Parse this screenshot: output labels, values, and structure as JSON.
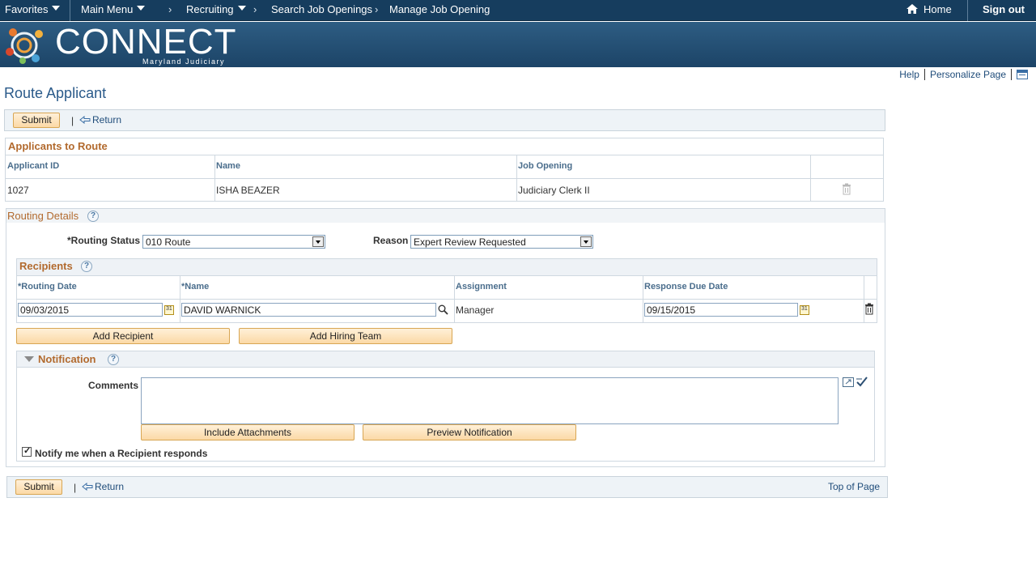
{
  "nav": {
    "favorites": "Favorites",
    "main_menu": "Main Menu",
    "crumbs": [
      "Recruiting",
      "Search Job Openings",
      "Manage Job Opening"
    ],
    "home": "Home",
    "sign_out": "Sign out"
  },
  "banner": {
    "logo_text": "CONNECT",
    "logo_sub": "Maryland Judiciary"
  },
  "page_links": {
    "help": "Help",
    "personalize": "Personalize Page"
  },
  "page_title": "Route Applicant",
  "toolbar": {
    "submit": "Submit",
    "return": "Return",
    "pipe": "|"
  },
  "applicants": {
    "title": "Applicants to Route",
    "headers": [
      "Applicant ID",
      "Name",
      "Job Opening"
    ],
    "rows": [
      {
        "id": "1027",
        "name": "ISHA BEAZER",
        "job": "Judiciary Clerk II"
      }
    ]
  },
  "routing": {
    "title": "Routing Details",
    "status_label": "*Routing Status",
    "status_value": "010 Route",
    "reason_label": "Reason",
    "reason_value": "Expert Review Requested"
  },
  "recipients": {
    "title": "Recipients",
    "headers": [
      "*Routing Date",
      "*Name",
      "Assignment",
      "Response Due Date"
    ],
    "rows": [
      {
        "date": "09/03/2015",
        "name": "DAVID WARNICK",
        "assignment": "Manager",
        "due": "09/15/2015"
      }
    ],
    "add_recipient": "Add Recipient",
    "add_hiring_team": "Add Hiring Team"
  },
  "notification": {
    "title": "Notification",
    "comments_label": "Comments",
    "comments_value": "",
    "include_attachments": "Include Attachments",
    "preview": "Preview Notification",
    "notify_label": "Notify me when a Recipient responds",
    "notify_checked": true
  },
  "bottom": {
    "submit": "Submit",
    "return": "Return",
    "pipe": "|",
    "top_of_page": "Top of Page"
  },
  "help_glyph": "?"
}
